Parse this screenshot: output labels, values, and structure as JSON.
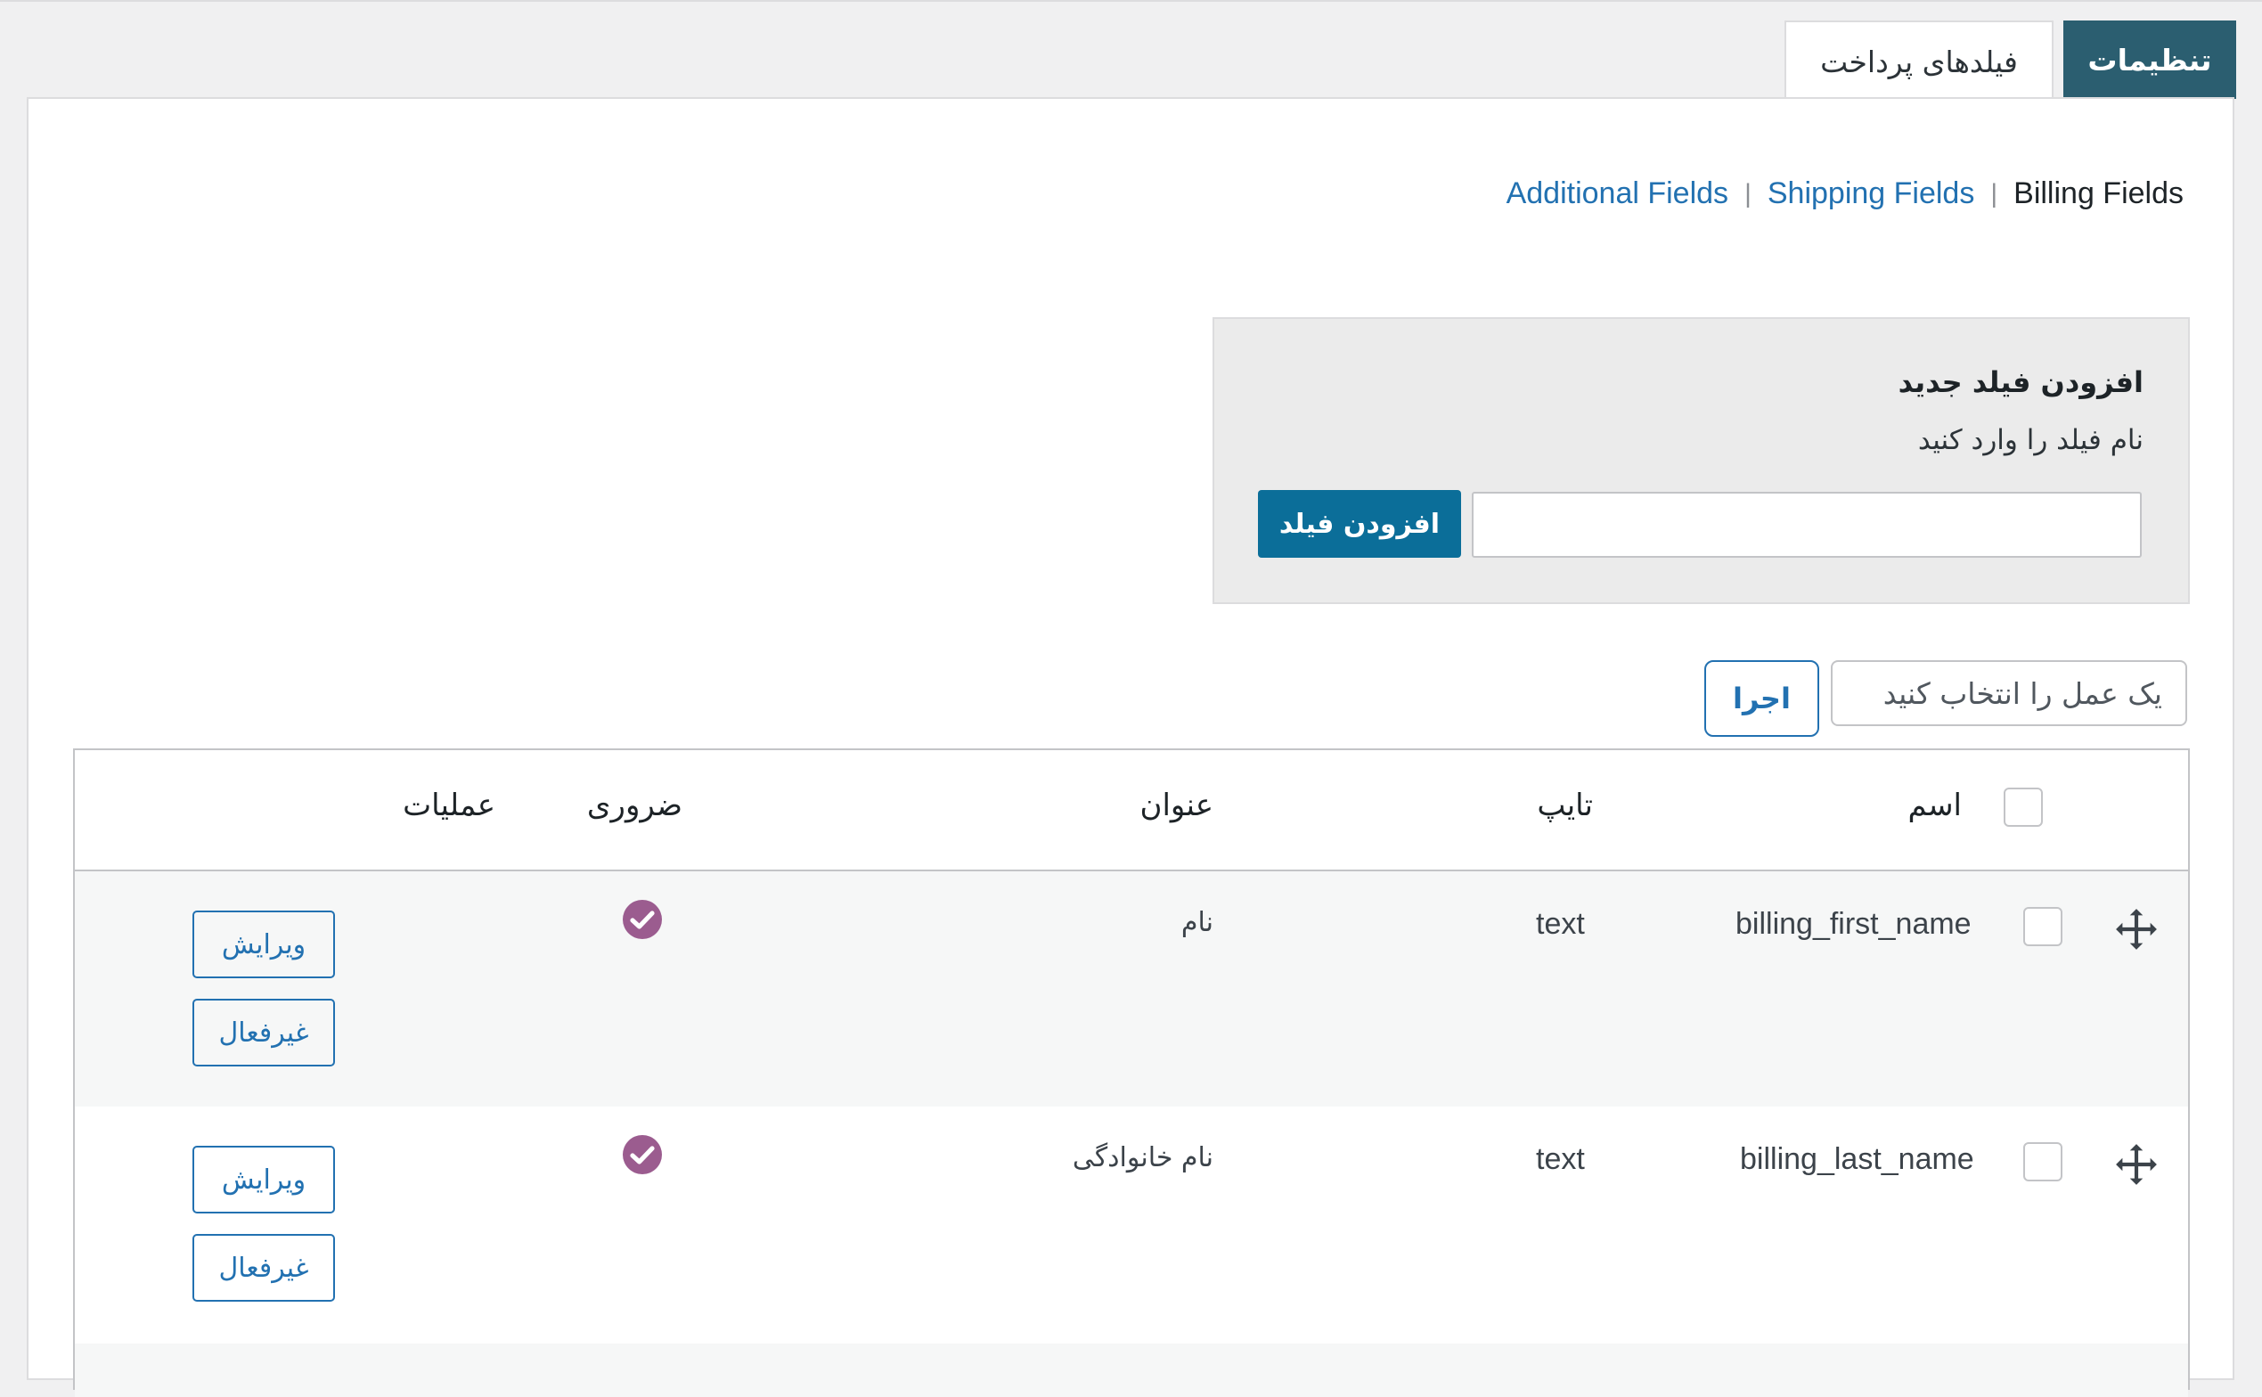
{
  "tabs": {
    "settings": "تنظیمات",
    "payment_fields": "فیلدهای پرداخت"
  },
  "subnav": {
    "billing": "Billing Fields",
    "shipping": "Shipping Fields",
    "additional": "Additional Fields",
    "separator": "|"
  },
  "add_field": {
    "heading": "افزودن فیلد جدید",
    "description": "نام فیلد را وارد کنید",
    "input_value": "",
    "button": "افزودن فیلد"
  },
  "bulk": {
    "select_label": "یک عمل را انتخاب کنید",
    "run_button": "اجرا"
  },
  "table": {
    "columns": {
      "name": "اسم",
      "type": "تایپ",
      "title": "عنوان",
      "required": "ضروری",
      "operations": "عملیات"
    },
    "rows": [
      {
        "name": "billing_first_name",
        "type": "text",
        "title": "نام",
        "required": true,
        "edit": "ویرایش",
        "disable": "غیرفعال"
      },
      {
        "name": "billing_last_name",
        "type": "text",
        "title": "نام خانوادگی",
        "required": true,
        "edit": "ویرایش",
        "disable": "غیرفعال"
      }
    ]
  },
  "icons": {
    "move": "move-arrows-icon",
    "required": "check-circle-icon"
  },
  "colors": {
    "accent": "#2271b1",
    "tab_active": "#2b5e70",
    "required_check": "#9b5c8f"
  }
}
